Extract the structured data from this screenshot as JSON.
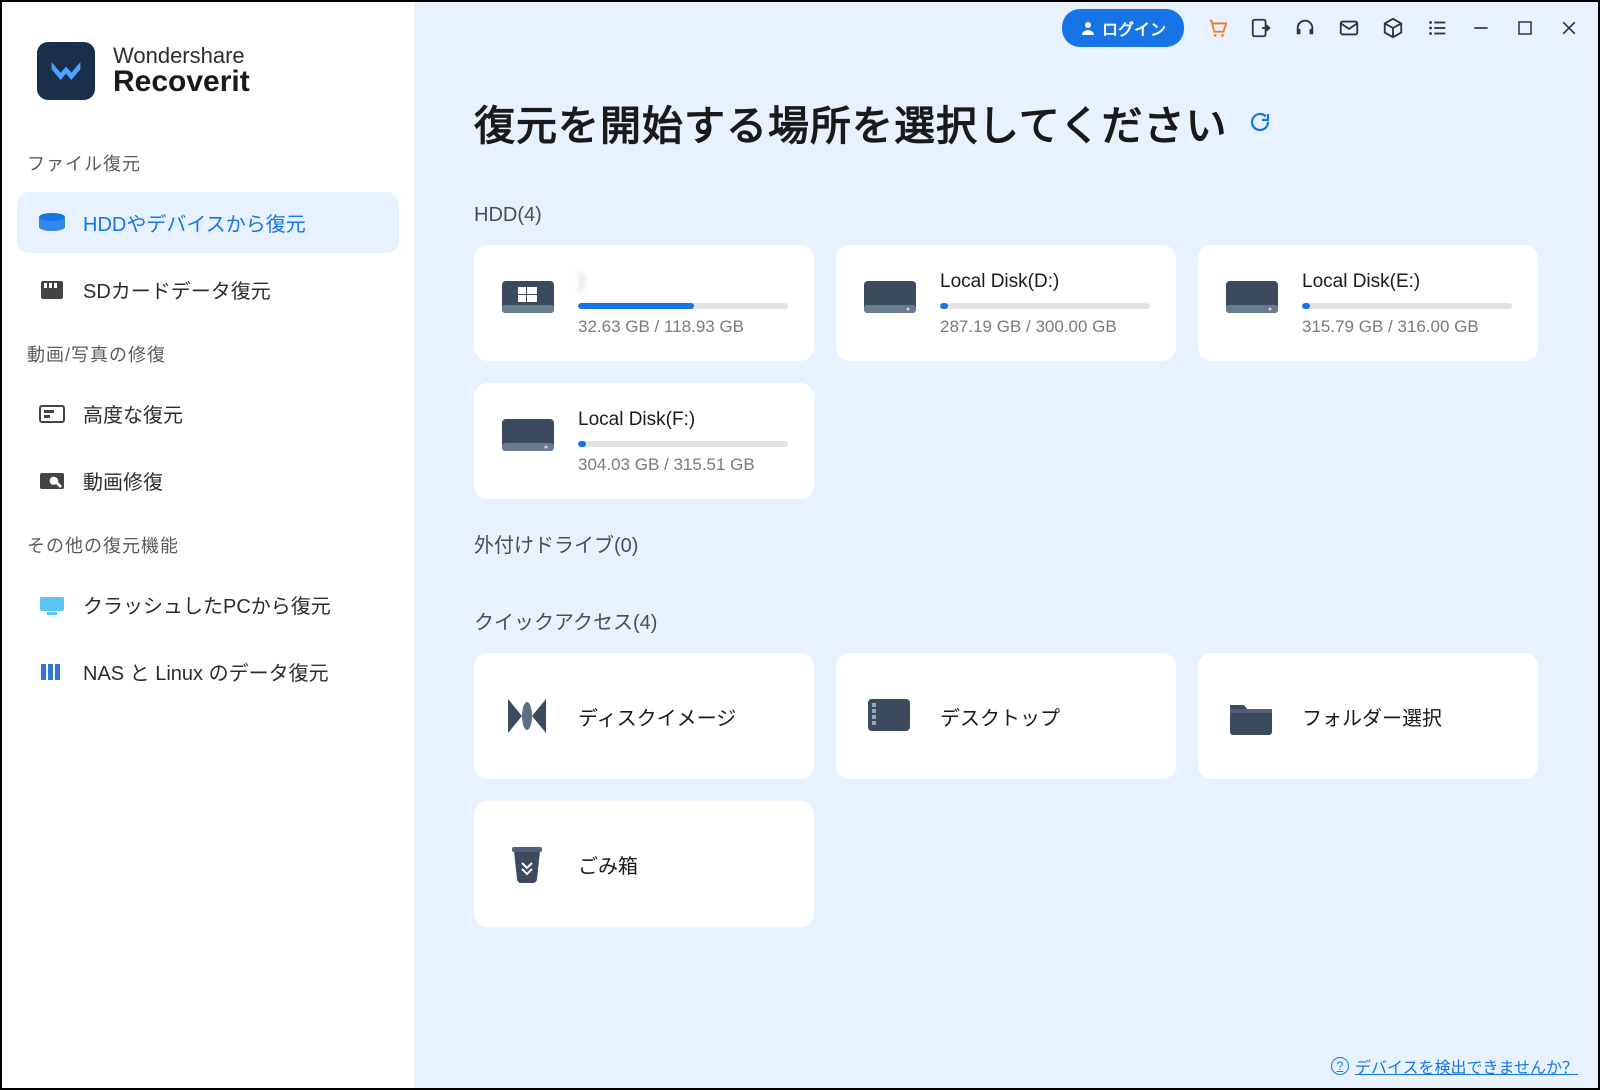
{
  "brand": {
    "company": "Wondershare",
    "product": "Recoverit"
  },
  "titlebar": {
    "login": "ログイン"
  },
  "sidebar": {
    "section1_label": "ファイル復元",
    "items1": [
      {
        "label": "HDDやデバイスから復元",
        "icon": "hdd"
      },
      {
        "label": "SDカードデータ復元",
        "icon": "sd"
      }
    ],
    "section2_label": "動画/写真の修復",
    "items2": [
      {
        "label": "高度な復元",
        "icon": "advanced"
      },
      {
        "label": "動画修復",
        "icon": "wrench"
      }
    ],
    "section3_label": "その他の復元機能",
    "items3": [
      {
        "label": "クラッシュしたPCから復元",
        "icon": "monitor"
      },
      {
        "label": "NAS と Linux のデータ復元",
        "icon": "nas"
      }
    ]
  },
  "main": {
    "title": "復元を開始する場所を選択してください",
    "sections": {
      "hdd_label": "HDD(4)",
      "external_label": "外付けドライブ(0)",
      "quick_label": "クイックアクセス(4)"
    },
    "disks": [
      {
        "name": ")",
        "blurred": true,
        "used": 32.63,
        "total": 118.93,
        "size_text": "32.63 GB / 118.93 GB",
        "pct": 55,
        "icon": "win"
      },
      {
        "name": "Local Disk(D:)",
        "used": 287.19,
        "total": 300.0,
        "size_text": "287.19 GB / 300.00 GB",
        "pct": 4,
        "icon": "hdd"
      },
      {
        "name": "Local Disk(E:)",
        "used": 315.79,
        "total": 316.0,
        "size_text": "315.79 GB / 316.00 GB",
        "pct": 4,
        "icon": "hdd"
      },
      {
        "name": "Local Disk(F:)",
        "used": 304.03,
        "total": 315.51,
        "size_text": "304.03 GB / 315.51 GB",
        "pct": 4,
        "icon": "hdd"
      }
    ],
    "quick": [
      {
        "label": "ディスクイメージ",
        "icon": "diskimg"
      },
      {
        "label": "デスクトップ",
        "icon": "desktop"
      },
      {
        "label": "フォルダー選択",
        "icon": "folder"
      },
      {
        "label": "ごみ箱",
        "icon": "trash"
      }
    ],
    "footer_link": "デバイスを検出できませんか？"
  }
}
